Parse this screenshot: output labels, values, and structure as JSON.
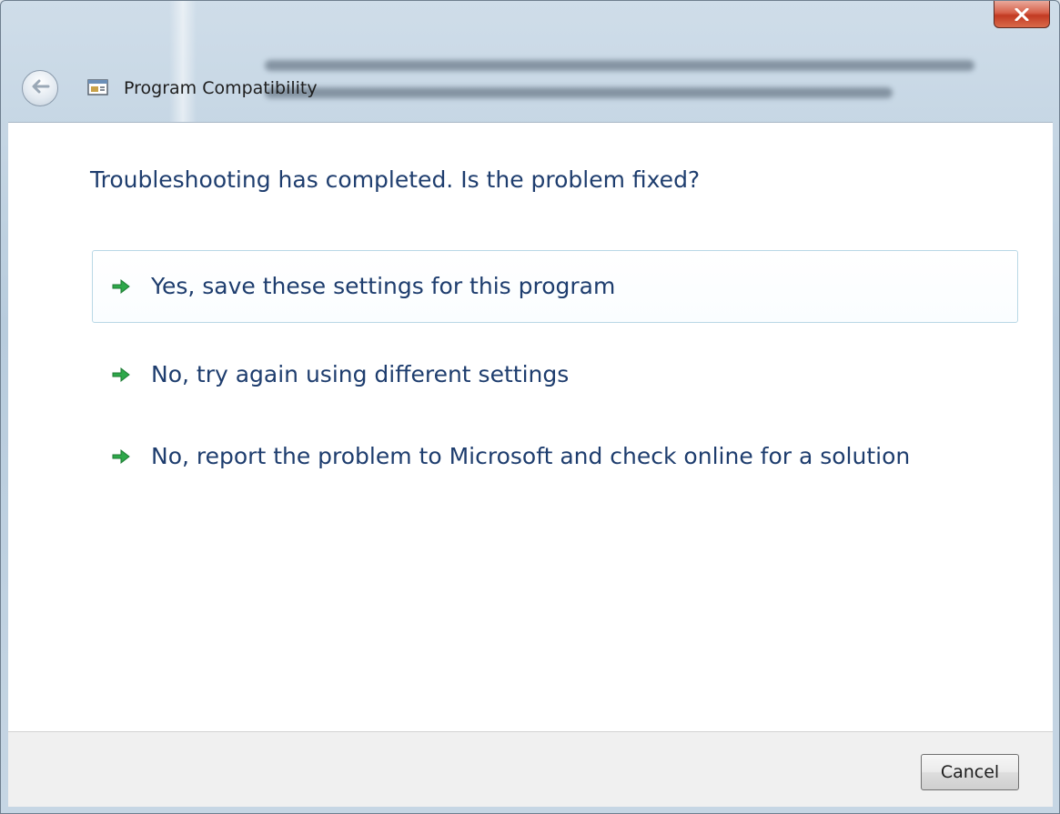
{
  "window": {
    "title": "Program Compatibility",
    "icons": {
      "back": "back-arrow-icon",
      "app": "program-compatibility-icon",
      "close": "close-x-icon",
      "option_arrow": "green-arrow-icon"
    },
    "accent_colors": {
      "heading_text": "#1e3d6e",
      "option_arrow": "#2ea84a",
      "close_button": "#c23a22"
    }
  },
  "main": {
    "heading": "Troubleshooting has completed.  Is the problem fixed?",
    "options": [
      {
        "label": "Yes, save these settings for this program",
        "highlighted": true
      },
      {
        "label": "No, try again using different settings",
        "highlighted": false
      },
      {
        "label": "No, report the problem to Microsoft and check online for a solution",
        "highlighted": false
      }
    ]
  },
  "footer": {
    "cancel_label": "Cancel"
  }
}
